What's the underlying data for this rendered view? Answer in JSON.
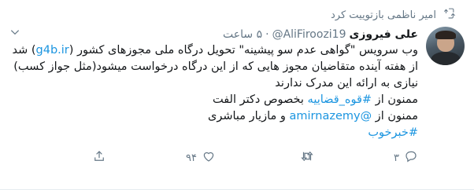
{
  "retweet_context": {
    "label": "امیر ناظمی بازتوییت کرد",
    "icon": "retweet-icon"
  },
  "author": {
    "name": "علی فیروزی",
    "handle": "@AliFiroozi19",
    "separator": "·",
    "time": "۵ ساعت"
  },
  "tweet": {
    "line1_pre": "وب سرویس \"گواهی عدم سو پیشینه\" تحویل درگاه ملی مجوزهای کشور (",
    "line1_link": "g4b.ir",
    "line1_post": ") شد",
    "line2": "از هفته آینده متقاضیان مجوز هایی که از این درگاه درخواست میشود(مثل جواز کسب) نیازی به ارائه این مدرک ندارند",
    "line3_pre": "ممنون از ",
    "line3_link": "#قوه_قضاییه",
    "line3_post": " بخصوص دکتر الفت",
    "line4_pre": "ممنون از ",
    "line4_link": "@amirnazemy",
    "line4_post": "  و مازیار مباشری",
    "line5_link": "#خبرخوب"
  },
  "actions": {
    "reply_count": "۳",
    "retweet_count": "",
    "like_count": "۹۴",
    "share_count": ""
  },
  "colors": {
    "link": "#1b95e0",
    "muted": "#657786",
    "text": "#14171a"
  }
}
